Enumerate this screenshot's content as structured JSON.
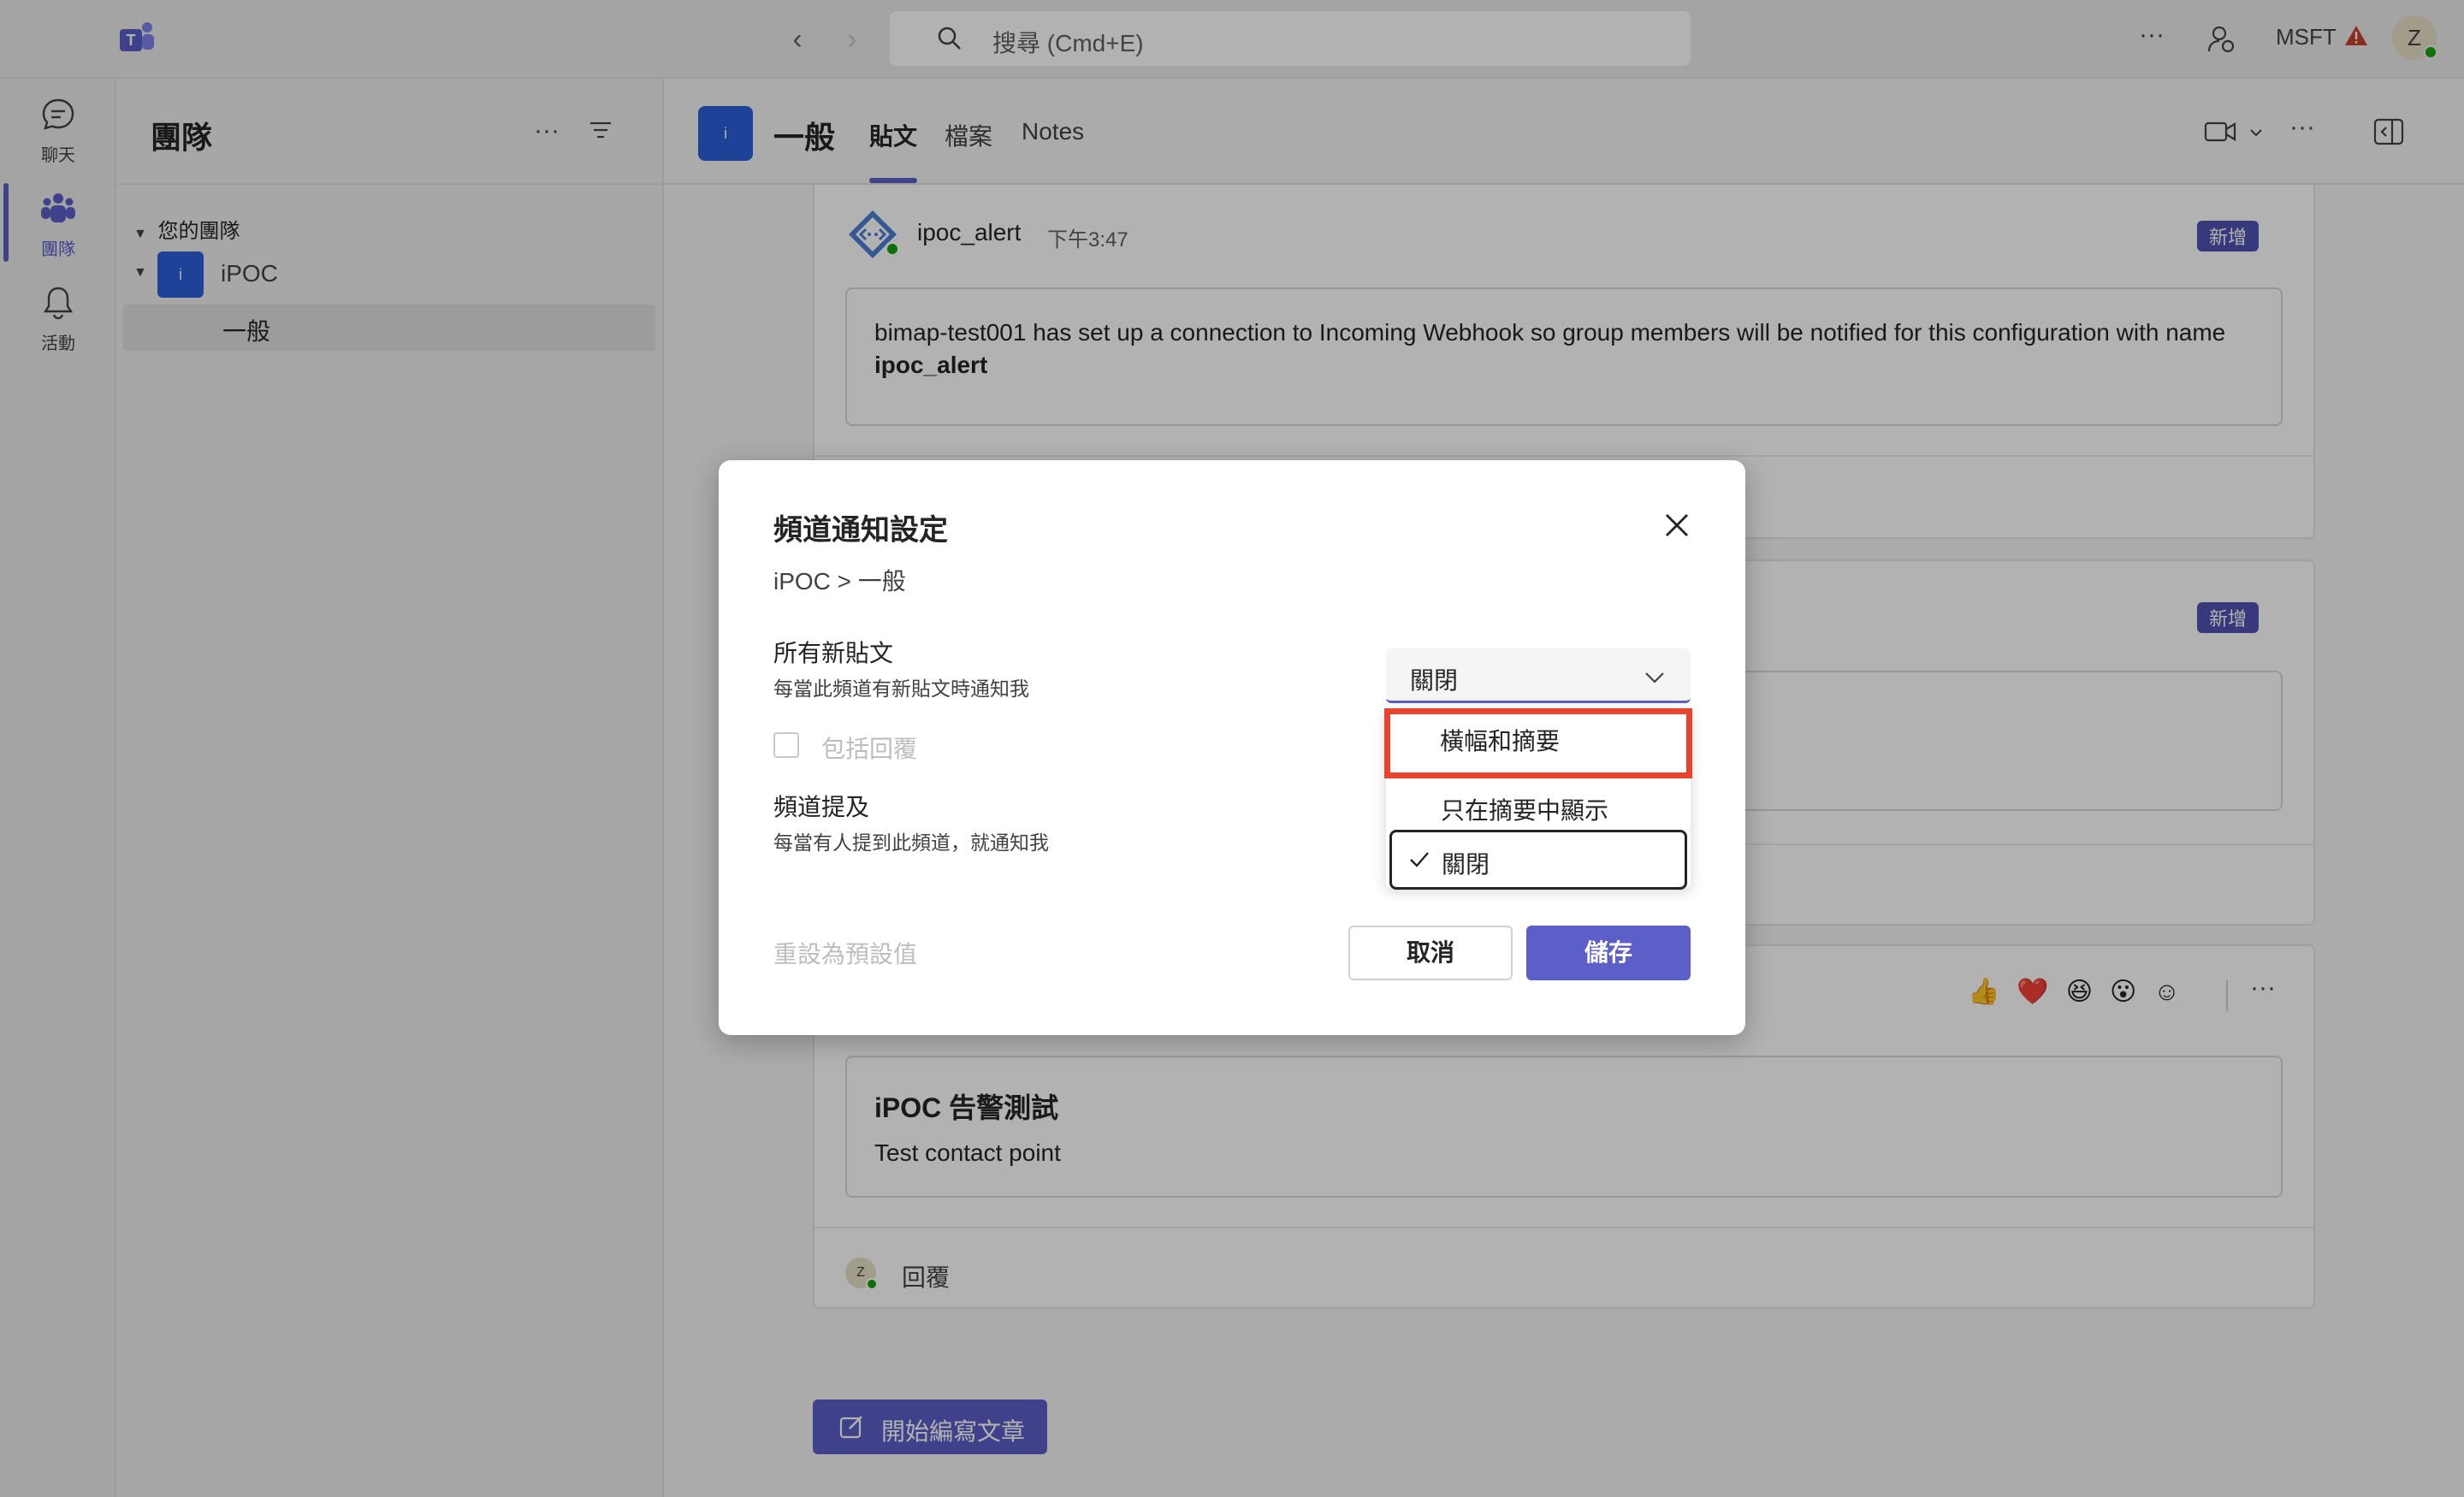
{
  "topbar": {
    "search_placeholder": "搜尋 (Cmd+E)",
    "org_label": "MSFT",
    "avatar_initial": "Z"
  },
  "rail": {
    "items": [
      {
        "label": "聊天",
        "icon": "chat-icon"
      },
      {
        "label": "團隊",
        "icon": "teams-icon"
      },
      {
        "label": "活動",
        "icon": "bell-icon"
      }
    ]
  },
  "teams_panel": {
    "title": "團隊",
    "section_label": "您的團隊",
    "team_name": "iPOC",
    "team_tile_letter": "i",
    "channel_name": "一般"
  },
  "channel_header": {
    "tile_letter": "i",
    "channel_name": "一般",
    "tabs": [
      "貼文",
      "檔案",
      "Notes"
    ]
  },
  "posts": {
    "first": {
      "author": "ipoc_alert",
      "time": "下午3:47",
      "badge": "新增",
      "body_prefix": "bimap-test001 has set up a connection to Incoming Webhook so group members will be notified for this configuration with name ",
      "body_bold": "ipoc_alert"
    },
    "second": {
      "badge": "新增"
    },
    "third": {
      "card_title": "iPOC 告警測試",
      "card_body": "Test contact point",
      "reply_label": "回覆",
      "reply_avatar": "Z"
    },
    "new_post_button": "開始編寫文章"
  },
  "dialog": {
    "title": "頻道通知設定",
    "breadcrumb": "iPOC > 一般",
    "all_posts_title": "所有新貼文",
    "all_posts_sub": "每當此頻道有新貼文時通知我",
    "include_replies": "包括回覆",
    "mentions_title": "頻道提及",
    "mentions_sub": "每當有人提到此頻道，就通知我",
    "reset": "重設為預設值",
    "cancel": "取消",
    "save": "儲存",
    "select_value": "關閉",
    "options": [
      "橫幅和摘要",
      "只在摘要中顯示",
      "關閉"
    ],
    "selected_option": "關閉"
  },
  "colors": {
    "accent": "#5b5fc7",
    "highlight_outline": "#e8432c",
    "team_tile": "#2b5fd9"
  }
}
